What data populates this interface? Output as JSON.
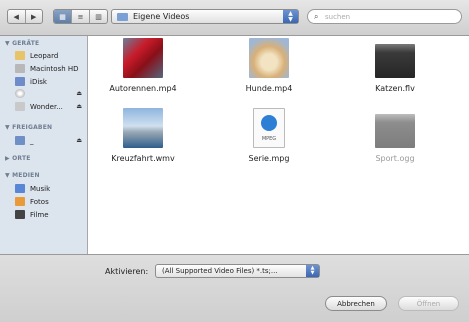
{
  "toolbar": {
    "nav": {
      "back_icon": "◀",
      "forward_icon": "▶"
    },
    "views": {
      "icon_view": "▦",
      "list_view": "≡",
      "column_view": "▥"
    },
    "location": "Eigene Videos",
    "search_placeholder": "suchen"
  },
  "sidebar": {
    "sections": [
      {
        "label": "▼ GERÄTE"
      },
      {
        "label": "▼ FREIGABEN"
      },
      {
        "label": "▶ ORTE"
      },
      {
        "label": "▼ MEDIEN"
      }
    ],
    "devices": [
      "Leopard",
      "Macintosh HD",
      "iDisk",
      "",
      "Wonder..."
    ],
    "shares": [
      "_"
    ],
    "media": [
      "Musik",
      "Fotos",
      "Filme"
    ],
    "eject_icon": "⏏"
  },
  "files": [
    {
      "name": "Autorennen.mp4",
      "thumb": "red-car-photo"
    },
    {
      "name": "Hunde.mp4",
      "thumb": "dog-photo"
    },
    {
      "name": "Katzen.flv",
      "thumb": "dark-video-thumb"
    },
    {
      "name": "Kreuzfahrt.wmv",
      "thumb": "cruise-ship-photo"
    },
    {
      "name": "Serie.mpg",
      "thumb": "mpeg-document-icon",
      "badge": "MPEG"
    },
    {
      "name": "Sport.ogg",
      "thumb": "gray-video-thumb",
      "disabled": true
    }
  ],
  "bottom": {
    "activate_label": "Aktivieren:",
    "activate_value": "(All Supported Video Files) *.ts;...",
    "cancel": "Abbrechen",
    "open": "Öffnen"
  },
  "colors": {
    "sidebar_bg": "#dce4ee",
    "section_text": "#6f7e91",
    "accent": "#3b67b3"
  }
}
